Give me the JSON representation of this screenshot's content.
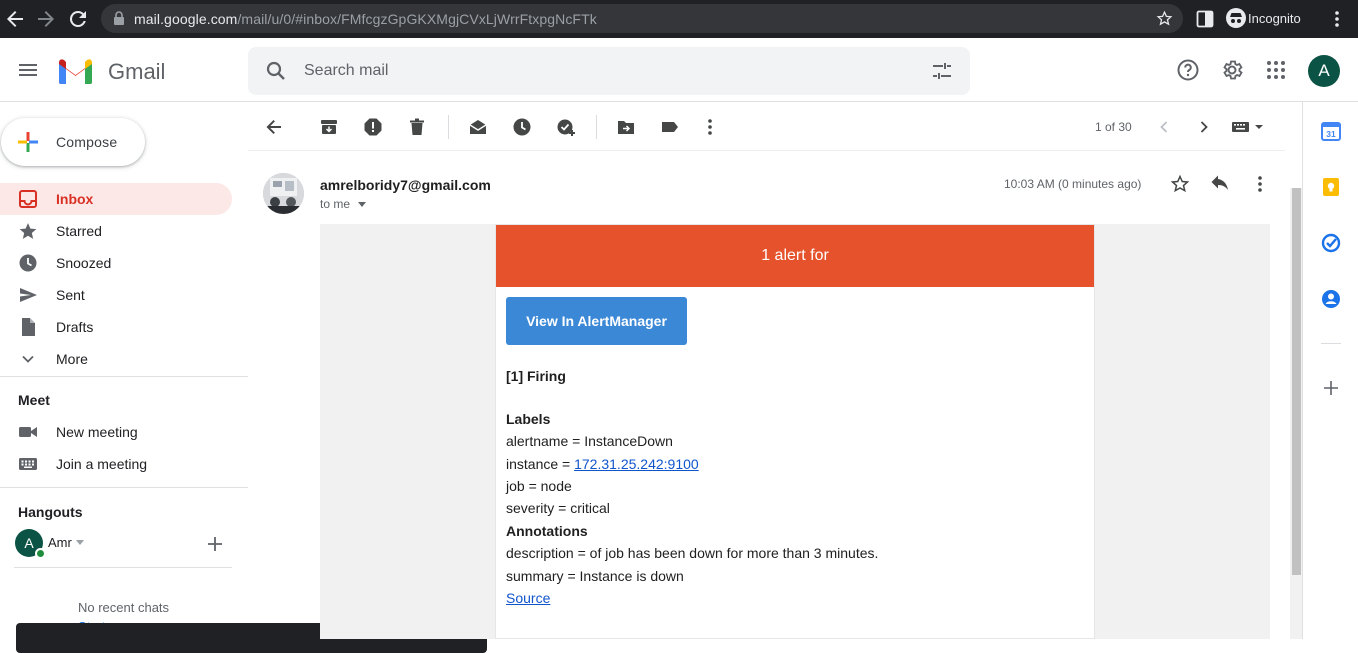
{
  "browser": {
    "url_host": "mail.google.com",
    "url_path": "/mail/u/0/#inbox/FMfcgzGpGKXMgjCVxLjWrrFtxpgNcFTk",
    "incognito_label": "Incognito"
  },
  "app": {
    "name": "Gmail",
    "search_placeholder": "Search mail",
    "avatar_letter": "A"
  },
  "sidebar": {
    "compose_label": "Compose",
    "items": [
      {
        "label": "Inbox",
        "icon": "inbox-icon",
        "active": true
      },
      {
        "label": "Starred",
        "icon": "star-icon"
      },
      {
        "label": "Snoozed",
        "icon": "clock-icon"
      },
      {
        "label": "Sent",
        "icon": "send-icon"
      },
      {
        "label": "Drafts",
        "icon": "draft-icon"
      },
      {
        "label": "More",
        "icon": "chevron-down-icon"
      }
    ],
    "meet": {
      "title": "Meet",
      "new_meeting": "New meeting",
      "join_meeting": "Join a meeting"
    },
    "hangouts": {
      "title": "Hangouts",
      "user_name": "Amr",
      "user_initial": "A",
      "no_chats": "No recent chats",
      "start_new": "Start a new one"
    }
  },
  "toolbar": {
    "page_count": "1 of 30"
  },
  "message": {
    "sender": "amrelboridy7@gmail.com",
    "to": "to me",
    "time": "10:03 AM (0 minutes ago)"
  },
  "email": {
    "banner": "1 alert for",
    "button": "View In AlertManager",
    "firing": "[1] Firing",
    "labels_title": "Labels",
    "alertname": "alertname = InstanceDown",
    "instance_prefix": "instance = ",
    "instance_link": "172.31.25.242:9100",
    "job": "job = node",
    "severity": "severity = critical",
    "annotations_title": "Annotations",
    "description": "description = of job has been down for more than 3 minutes.",
    "summary": "summary = Instance is down",
    "source": "Source"
  },
  "colors": {
    "banner": "#e6522c",
    "button": "#3a88d6",
    "inbox_active_bg": "#fce8e6",
    "inbox_active_text": "#d93025",
    "link": "#1155cc"
  }
}
